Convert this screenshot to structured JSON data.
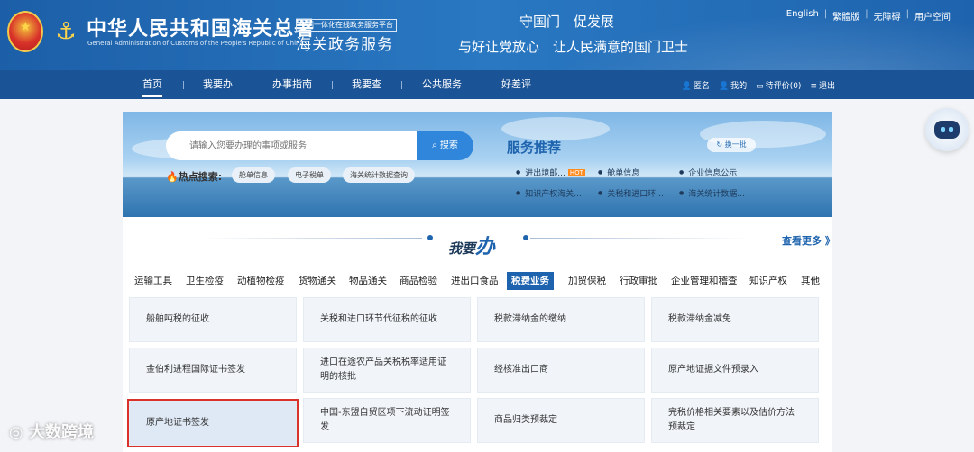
{
  "header": {
    "org_cn": "中华人民共和国海关总署",
    "org_en": "General Administration of Customs of the People's Republic of China",
    "platform_tag": "全国一体化在线政务服务平台",
    "service_name": "海关政务服务",
    "slogan1": "守国门　促发展",
    "slogan2": "与好让党放心　让人民满意的国门卫士",
    "top_links": [
      "English",
      "繁體版",
      "无障碍",
      "用户空间"
    ]
  },
  "nav": {
    "items": [
      "首页",
      "我要办",
      "办事指南",
      "我要查",
      "公共服务",
      "好差评"
    ],
    "right": [
      "匿名",
      "我的",
      "待评价(0)",
      "退出"
    ]
  },
  "search": {
    "placeholder": "请输入您要办理的事项或服务",
    "button": "搜索",
    "hot_label": "热点搜索:",
    "hot_tags": [
      "舱单信息",
      "电子税单",
      "海关统计数据查询"
    ]
  },
  "recommend": {
    "title": "服务推荐",
    "refresh": "换一批",
    "hot_badge": "HOT",
    "items": [
      "进出境邮...",
      "舱单信息",
      "企业信息公示",
      "知识产权海关...",
      "关税和进口环...",
      "海关统计数据..."
    ]
  },
  "section": {
    "title_prefix": "我要",
    "title_emph": "办",
    "more": "查看更多 》"
  },
  "tabs": [
    "运输工具",
    "卫生检疫",
    "动植物检疫",
    "货物通关",
    "物品通关",
    "商品检验",
    "进出口食品",
    "税费业务",
    "加贸保税",
    "行政审批",
    "企业管理和稽查",
    "知识产权",
    "其他"
  ],
  "active_tab": "税费业务",
  "grid": [
    [
      "船舶吨税的征收",
      "关税和进口环节代征税的征收",
      "税款滞纳金的缴纳",
      "税款滞纳金减免"
    ],
    [
      "金伯利进程国际证书签发",
      "进口在途农产品关税税率适用证明的核批",
      "经核准出口商",
      "原产地证据文件预录入"
    ],
    [
      "原产地证书签发",
      "中国-东盟自贸区项下流动证明签发",
      "商品归类预裁定",
      "完税价格相关要素以及估价方法预裁定"
    ]
  ],
  "watermark": "大数跨境"
}
